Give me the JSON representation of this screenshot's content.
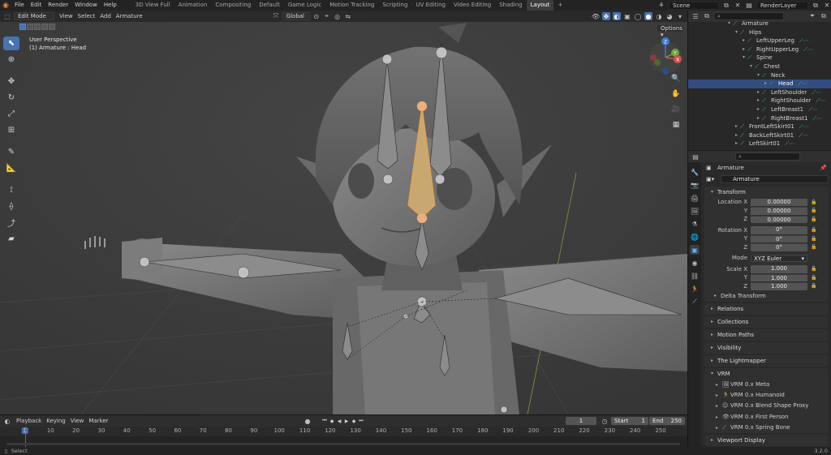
{
  "menu": [
    "File",
    "Edit",
    "Render",
    "Window",
    "Help"
  ],
  "workspaces": [
    "3D View Full",
    "Animation",
    "Compositing",
    "Default",
    "Game Logic",
    "Motion Tracking",
    "Scripting",
    "UV Editing",
    "Video Editing",
    "Shading",
    "Layout",
    "+"
  ],
  "active_workspace": "Layout",
  "scene_name": "Scene",
  "render_layer": "RenderLayer",
  "viewport": {
    "mode": "Edit Mode",
    "menus": [
      "View",
      "Select",
      "Add",
      "Armature"
    ],
    "transform_orientation": "Global",
    "options_label": "Options",
    "perspective": "User Perspective",
    "active_object": "(1) Armature : Head",
    "gizmo_axes": [
      "Z",
      "Y",
      "X"
    ]
  },
  "outliner": {
    "rows": [
      {
        "label": "Armature",
        "depth": 5,
        "arrow": "▾",
        "icon": true
      },
      {
        "label": "Hips",
        "depth": 6,
        "arrow": "▾",
        "icon": true
      },
      {
        "label": "LeftUpperLeg",
        "depth": 7,
        "arrow": "▸",
        "icon": true,
        "extra": true
      },
      {
        "label": "RightUpperLeg",
        "depth": 7,
        "arrow": "▸",
        "icon": true,
        "extra": true
      },
      {
        "label": "Spine",
        "depth": 7,
        "arrow": "▾",
        "icon": true
      },
      {
        "label": "Chest",
        "depth": 8,
        "arrow": "▾",
        "icon": true
      },
      {
        "label": "Neck",
        "depth": 9,
        "arrow": "▾",
        "icon": true
      },
      {
        "label": "Head",
        "depth": 10,
        "arrow": "▸",
        "icon": true,
        "extra": true,
        "selected": true
      },
      {
        "label": "LeftShoulder",
        "depth": 9,
        "arrow": "▸",
        "icon": true,
        "extra": true
      },
      {
        "label": "RightShoulder",
        "depth": 9,
        "arrow": "▸",
        "icon": true,
        "extra": true
      },
      {
        "label": "LeftBreast1",
        "depth": 9,
        "arrow": "▸",
        "icon": true,
        "extra": true
      },
      {
        "label": "RightBreast1",
        "depth": 9,
        "arrow": "▸",
        "icon": true,
        "extra": true
      },
      {
        "label": "FrontLeftSkirt01",
        "depth": 6,
        "arrow": "▸",
        "icon": true,
        "extra": true
      },
      {
        "label": "BackLeftSkirt01",
        "depth": 6,
        "arrow": "▸",
        "icon": true,
        "extra": true
      },
      {
        "label": "LeftSkirt01",
        "depth": 6,
        "arrow": "▸",
        "icon": true,
        "extra": true
      }
    ]
  },
  "properties": {
    "object_name": "Armature",
    "data_name": "Armature",
    "transform_label": "Transform",
    "location": {
      "label": "Location X",
      "x": "0.00000",
      "y": "0.00000",
      "z": "0.00000"
    },
    "rotation": {
      "label": "Rotation X",
      "x": "0°",
      "y": "0°",
      "z": "0°"
    },
    "mode": {
      "label": "Mode",
      "value": "XYZ Euler"
    },
    "scale": {
      "label": "Scale X",
      "x": "1.000",
      "y": "1.000",
      "z": "1.000"
    },
    "axis_y": "Y",
    "axis_z": "Z",
    "delta_transform": "Delta Transform",
    "panels": [
      "Relations",
      "Collections",
      "Motion Paths",
      "Visibility",
      "The Lightmapper"
    ],
    "vrm_label": "VRM",
    "vrm_items": [
      "VRM 0.x Meta",
      "VRM 0.x Humanoid",
      "VRM 0.x Blend Shape Proxy",
      "VRM 0.x First Person",
      "VRM 0.x Spring Bone"
    ],
    "viewport_display": "Viewport Display"
  },
  "timeline": {
    "menus": [
      "Playback",
      "Keying",
      "View",
      "Marker"
    ],
    "current_frame": "1",
    "start_label": "Start",
    "start": "1",
    "end_label": "End",
    "end": "250",
    "ticks": [
      "1",
      "10",
      "20",
      "30",
      "40",
      "50",
      "60",
      "70",
      "80",
      "90",
      "100",
      "110",
      "120",
      "130",
      "140",
      "150",
      "160",
      "170",
      "180",
      "190",
      "200",
      "210",
      "220",
      "230",
      "240",
      "250"
    ]
  },
  "status": {
    "select": "Select",
    "version": "3.2.0"
  },
  "colors": {
    "accent": "#4772b3",
    "bone": "#49c0b0",
    "selected_row": "#334d80",
    "active_bone": "#e8a04a"
  }
}
